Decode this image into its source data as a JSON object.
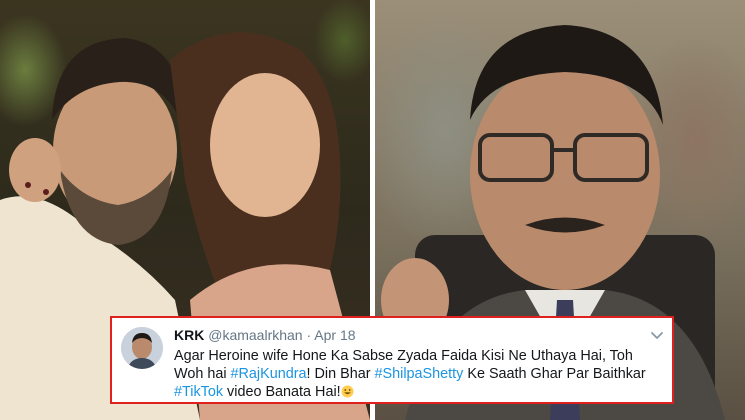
{
  "tweet": {
    "display_name": "KRK",
    "handle": "@kamaalrkhan",
    "separator": "·",
    "date": "Apr 18",
    "text_part1": "Agar Heroine wife Hone Ka Sabse Zyada Faida Kisi Ne Uthaya Hai, Toh Woh hai ",
    "hashtag1": "#RajKundra",
    "text_part2": "! Din Bhar ",
    "hashtag2": "#ShilpaShetty",
    "text_part3": " Ke Saath Ghar Par Baithkar ",
    "hashtag3": "#TikTok",
    "text_part4": " video Banata Hai!",
    "emoji": "grinning-face"
  },
  "photos": {
    "left": "couple-photo",
    "right": "man-with-glasses-photo"
  },
  "colors": {
    "card_border": "#e0201f",
    "hashtag": "#1b95e0",
    "name": "#14171a",
    "meta": "#657786"
  }
}
